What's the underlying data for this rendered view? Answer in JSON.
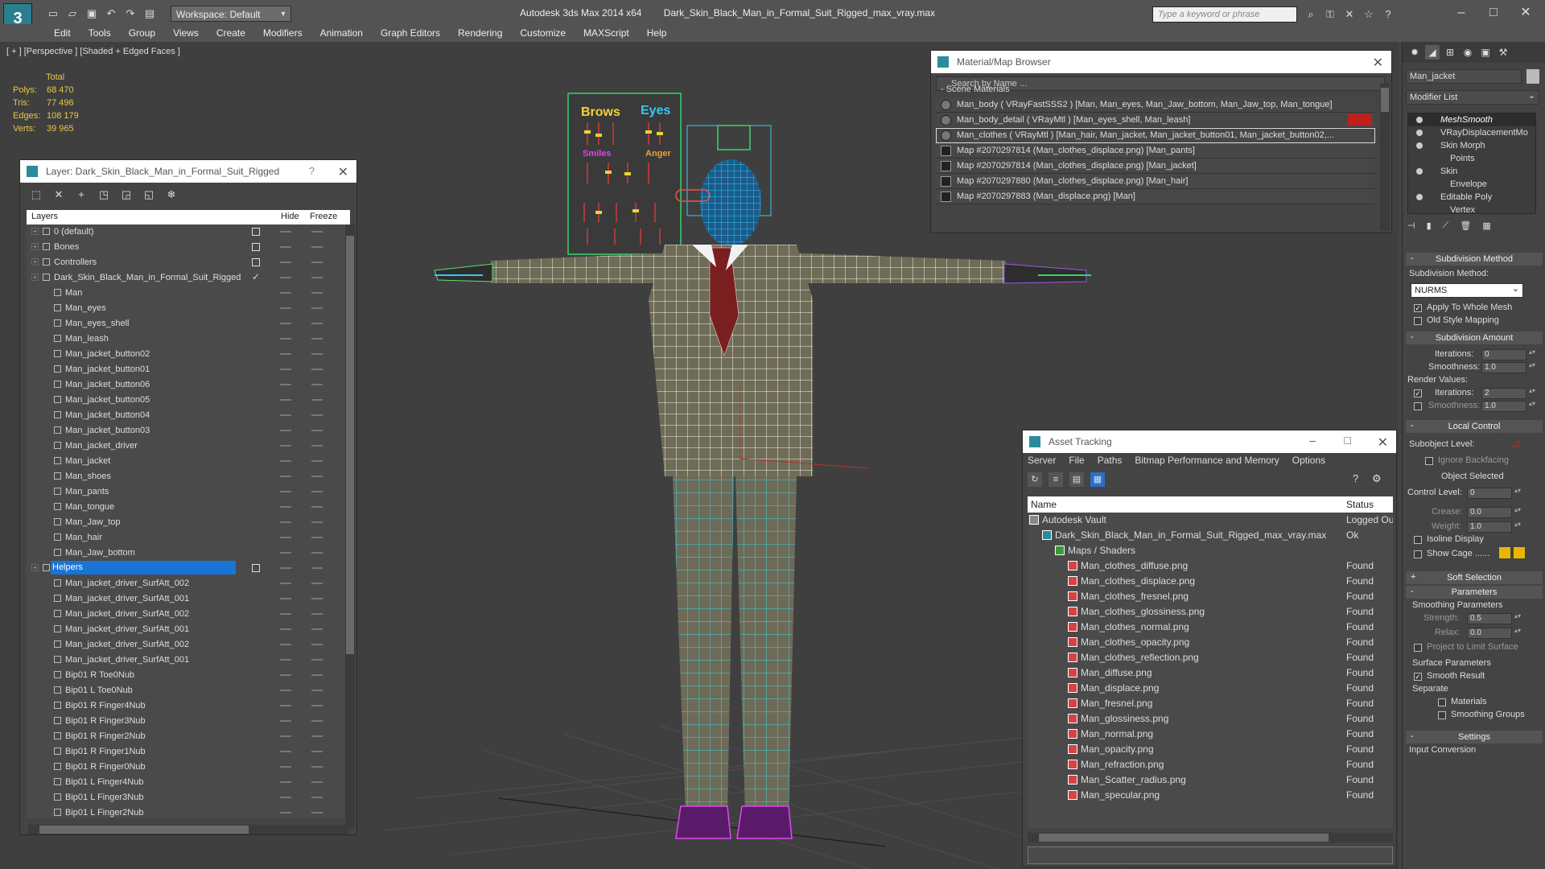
{
  "app": {
    "logo": "3",
    "workspace": "Workspace: Default",
    "title_app": "Autodesk 3ds Max  2014 x64",
    "title_file": "Dark_Skin_Black_Man_in_Formal_Suit_Rigged_max_vray.max",
    "search_placeholder": "Type a keyword or phrase"
  },
  "menu": [
    "Edit",
    "Tools",
    "Group",
    "Views",
    "Create",
    "Modifiers",
    "Animation",
    "Graph Editors",
    "Rendering",
    "Customize",
    "MAXScript",
    "Help"
  ],
  "viewport": {
    "label": "[ + ] [Perspective ] [Shaded + Edged Faces ]",
    "stats": {
      "total_label": "Total",
      "rows": [
        {
          "k": "Polys:",
          "v": "68 470"
        },
        {
          "k": "Tris:",
          "v": "77 496"
        },
        {
          "k": "Edges:",
          "v": "108 179"
        },
        {
          "k": "Verts:",
          "v": "39 965"
        }
      ]
    },
    "board_labels": {
      "brows": "Brows",
      "eyes": "Eyes",
      "smiles": "Smiles",
      "anger": "Anger"
    }
  },
  "layer_panel": {
    "title": "Layer: Dark_Skin_Black_Man_in_Formal_Suit_Rigged",
    "col_layers": "Layers",
    "col_hide": "Hide",
    "col_freeze": "Freeze",
    "rows": [
      {
        "name": "0 (default)",
        "level": 0,
        "mark": "box"
      },
      {
        "name": "Bones",
        "level": 0,
        "mark": "box"
      },
      {
        "name": "Controllers",
        "level": 0,
        "mark": "box"
      },
      {
        "name": "Dark_Skin_Black_Man_in_Formal_Suit_Rigged",
        "level": 0,
        "mark": "check"
      },
      {
        "name": "Man",
        "level": 1
      },
      {
        "name": "Man_eyes",
        "level": 1
      },
      {
        "name": "Man_eyes_shell",
        "level": 1
      },
      {
        "name": "Man_leash",
        "level": 1
      },
      {
        "name": "Man_jacket_button02",
        "level": 1
      },
      {
        "name": "Man_jacket_button01",
        "level": 1
      },
      {
        "name": "Man_jacket_button06",
        "level": 1
      },
      {
        "name": "Man_jacket_button05",
        "level": 1
      },
      {
        "name": "Man_jacket_button04",
        "level": 1
      },
      {
        "name": "Man_jacket_button03",
        "level": 1
      },
      {
        "name": "Man_jacket_driver",
        "level": 1
      },
      {
        "name": "Man_jacket",
        "level": 1
      },
      {
        "name": "Man_shoes",
        "level": 1
      },
      {
        "name": "Man_pants",
        "level": 1
      },
      {
        "name": "Man_tongue",
        "level": 1
      },
      {
        "name": "Man_Jaw_top",
        "level": 1
      },
      {
        "name": "Man_hair",
        "level": 1
      },
      {
        "name": "Man_Jaw_bottom",
        "level": 1
      },
      {
        "name": "Helpers",
        "level": 0,
        "mark": "box",
        "selected": true
      },
      {
        "name": "Man_jacket_driver_SurfAtt_002",
        "level": 1
      },
      {
        "name": "Man_jacket_driver_SurfAtt_001",
        "level": 1
      },
      {
        "name": "Man_jacket_driver_SurfAtt_002",
        "level": 1
      },
      {
        "name": "Man_jacket_driver_SurfAtt_001",
        "level": 1
      },
      {
        "name": "Man_jacket_driver_SurfAtt_002",
        "level": 1
      },
      {
        "name": "Man_jacket_driver_SurfAtt_001",
        "level": 1
      },
      {
        "name": "Bip01 R Toe0Nub",
        "level": 1
      },
      {
        "name": "Bip01 L Toe0Nub",
        "level": 1
      },
      {
        "name": "Bip01 R Finger4Nub",
        "level": 1
      },
      {
        "name": "Bip01 R Finger3Nub",
        "level": 1
      },
      {
        "name": "Bip01 R Finger2Nub",
        "level": 1
      },
      {
        "name": "Bip01 R Finger1Nub",
        "level": 1
      },
      {
        "name": "Bip01 R Finger0Nub",
        "level": 1
      },
      {
        "name": "Bip01 L Finger4Nub",
        "level": 1
      },
      {
        "name": "Bip01 L Finger3Nub",
        "level": 1
      },
      {
        "name": "Bip01 L Finger2Nub",
        "level": 1
      }
    ]
  },
  "material_browser": {
    "title": "Material/Map Browser",
    "search": "Search by Name ...",
    "section": "- Scene Materials",
    "rows": [
      {
        "text": "Man_body  ( VRayFastSSS2 ) [Man, Man_eyes, Man_Jaw_bottom, Man_Jaw_top, Man_tongue]",
        "kind": "mat"
      },
      {
        "text": "Man_body_detail  ( VRayMtl ) [Man_eyes_shell, Man_leash]",
        "kind": "mat",
        "flag": true
      },
      {
        "text": "Man_clothes  ( VRayMtl ) [Man_hair, Man_jacket, Man_jacket_button01, Man_jacket_button02,...",
        "kind": "mat",
        "selected": true
      },
      {
        "text": "Map #2070297814 (Man_clothes_displace.png) [Man_pants]",
        "kind": "map"
      },
      {
        "text": "Map #2070297814 (Man_clothes_displace.png) [Man_jacket]",
        "kind": "map"
      },
      {
        "text": "Map #2070297880 (Man_clothes_displace.png) [Man_hair]",
        "kind": "map"
      },
      {
        "text": "Map #2070297883 (Man_displace.png) [Man]",
        "kind": "map"
      }
    ]
  },
  "asset_tracking": {
    "title": "Asset Tracking",
    "menu": [
      "Server",
      "File",
      "Paths",
      "Bitmap Performance and Memory",
      "Options"
    ],
    "col_name": "Name",
    "col_status": "Status",
    "rows": [
      {
        "name": "Autodesk Vault",
        "status": "Logged Ou",
        "indent": 18
      },
      {
        "name": "Dark_Skin_Black_Man_in_Formal_Suit_Rigged_max_vray.max",
        "status": "Ok",
        "indent": 34
      },
      {
        "name": "Maps / Shaders",
        "status": "",
        "indent": 50
      },
      {
        "name": "Man_clothes_diffuse.png",
        "status": "Found",
        "indent": 66,
        "png": true
      },
      {
        "name": "Man_clothes_displace.png",
        "status": "Found",
        "indent": 66,
        "png": true
      },
      {
        "name": "Man_clothes_fresnel.png",
        "status": "Found",
        "indent": 66,
        "png": true
      },
      {
        "name": "Man_clothes_glossiness.png",
        "status": "Found",
        "indent": 66,
        "png": true
      },
      {
        "name": "Man_clothes_normal.png",
        "status": "Found",
        "indent": 66,
        "png": true
      },
      {
        "name": "Man_clothes_opacity.png",
        "status": "Found",
        "indent": 66,
        "png": true
      },
      {
        "name": "Man_clothes_reflection.png",
        "status": "Found",
        "indent": 66,
        "png": true
      },
      {
        "name": "Man_diffuse.png",
        "status": "Found",
        "indent": 66,
        "png": true
      },
      {
        "name": "Man_displace.png",
        "status": "Found",
        "indent": 66,
        "png": true
      },
      {
        "name": "Man_fresnel.png",
        "status": "Found",
        "indent": 66,
        "png": true
      },
      {
        "name": "Man_glossiness.png",
        "status": "Found",
        "indent": 66,
        "png": true
      },
      {
        "name": "Man_normal.png",
        "status": "Found",
        "indent": 66,
        "png": true
      },
      {
        "name": "Man_opacity.png",
        "status": "Found",
        "indent": 66,
        "png": true
      },
      {
        "name": "Man_refraction.png",
        "status": "Found",
        "indent": 66,
        "png": true
      },
      {
        "name": "Man_Scatter_radius.png",
        "status": "Found",
        "indent": 66,
        "png": true
      },
      {
        "name": "Man_specular.png",
        "status": "Found",
        "indent": 66,
        "png": true
      }
    ]
  },
  "command_panel": {
    "object_name": "Man_jacket",
    "modifier_list": "Modifier List",
    "stack": [
      {
        "name": "MeshSmooth",
        "hl": true
      },
      {
        "name": "VRayDisplacementMo",
        "sub": false
      },
      {
        "name": "Skin Morph"
      },
      {
        "name": "Points",
        "sub": true
      },
      {
        "name": "Skin"
      },
      {
        "name": "Envelope",
        "sub": true
      },
      {
        "name": "Editable Poly"
      },
      {
        "name": "Vertex",
        "sub": true
      }
    ],
    "subdiv_method_roll": "Subdivision Method",
    "subdiv_method_label": "Subdivision Method:",
    "subdiv_method_value": "NURMS",
    "apply_whole_mesh": "Apply To Whole Mesh",
    "old_style": "Old Style Mapping",
    "subdiv_amount_roll": "Subdivision Amount",
    "iterations_label": "Iterations:",
    "iterations_value": "0",
    "smoothness_label": "Smoothness:",
    "smoothness_value": "1.0",
    "render_values": "Render Values:",
    "r_iterations_label": "Iterations:",
    "r_iterations_value": "2",
    "r_smoothness_label": "Smoothness:",
    "r_smoothness_value": "1.0",
    "local_control_roll": "Local Control",
    "subobject_level": "Subobject Level:",
    "ignore_backfacing": "Ignore Backfacing",
    "object_selected": "Object Selected",
    "control_level": "Control Level:",
    "control_level_value": "0",
    "crease": "Crease:",
    "crease_value": "0.0",
    "weight": "Weight:",
    "weight_value": "1.0",
    "isoline": "Isoline Display",
    "show_cage": "Show Cage ......",
    "soft_selection_roll": "Soft Selection",
    "parameters_roll": "Parameters",
    "smoothing_params": "Smoothing Parameters",
    "strength": "Strength:",
    "strength_value": "0.5",
    "relax": "Relax:",
    "relax_value": "0.0",
    "project_limit": "Project to Limit Surface",
    "surface_params": "Surface Parameters",
    "smooth_result": "Smooth Result",
    "separate": "Separate",
    "materials": "Materials",
    "smoothing_groups": "Smoothing Groups",
    "settings_roll": "Settings",
    "input_conversion": "Input Conversion"
  }
}
